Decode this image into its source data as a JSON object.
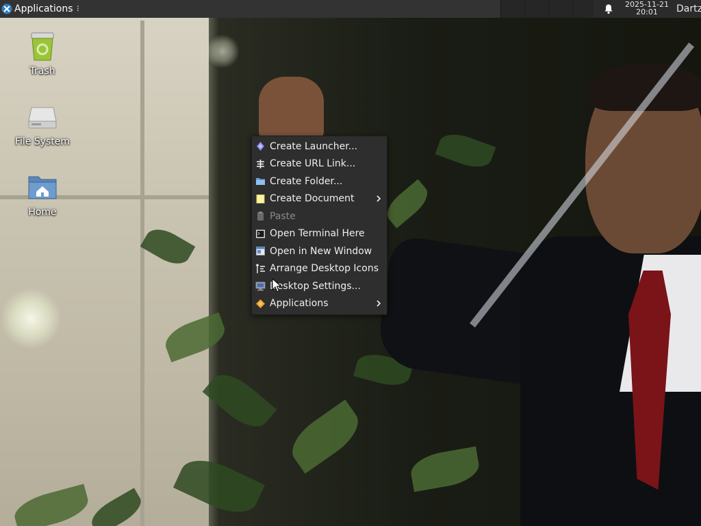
{
  "panel": {
    "applications_label": "Applications",
    "grip": "⠇",
    "clock_date": "2025-11-21",
    "clock_time": "20:01",
    "user_name": "Dartz",
    "notification_icon": "bell-icon"
  },
  "desktop_icons": [
    {
      "label": "Trash",
      "icon": "trash-icon"
    },
    {
      "label": "File System",
      "icon": "drive-icon"
    },
    {
      "label": "Home",
      "icon": "home-folder-icon"
    }
  ],
  "context_menu": {
    "items": [
      {
        "label": "Create Launcher...",
        "icon": "launcher-icon",
        "enabled": true,
        "submenu": false
      },
      {
        "label": "Create URL Link...",
        "icon": "url-link-icon",
        "enabled": true,
        "submenu": false
      },
      {
        "label": "Create Folder...",
        "icon": "folder-icon",
        "enabled": true,
        "submenu": false
      },
      {
        "label": "Create Document",
        "icon": "document-icon",
        "enabled": true,
        "submenu": true
      },
      {
        "label": "Paste",
        "icon": "paste-icon",
        "enabled": false,
        "submenu": false
      },
      {
        "label": "Open Terminal Here",
        "icon": "terminal-icon",
        "enabled": true,
        "submenu": false
      },
      {
        "label": "Open in New Window",
        "icon": "window-icon",
        "enabled": true,
        "submenu": false
      },
      {
        "label": "Arrange Desktop Icons",
        "icon": "arrange-icon",
        "enabled": true,
        "submenu": false
      },
      {
        "label": "Desktop Settings...",
        "icon": "desktop-settings-icon",
        "enabled": true,
        "submenu": false
      },
      {
        "label": "Applications",
        "icon": "applications-icon",
        "enabled": true,
        "submenu": true
      }
    ]
  },
  "colors": {
    "panel_bg": "#333333",
    "menu_bg": "#2e2e2e",
    "menu_text": "#eeeeee",
    "disabled_text": "#8a8a8a"
  }
}
